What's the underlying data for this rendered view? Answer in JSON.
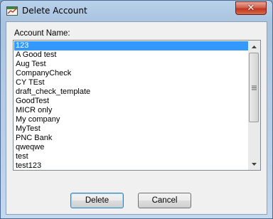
{
  "window": {
    "title": "Delete Account",
    "close_symbol": "✕",
    "icon": "app-icon"
  },
  "form": {
    "label": "Account Name:",
    "accounts": [
      "123",
      "A Good test",
      "Aug Test",
      "CompanyCheck",
      "CY TEst",
      "draft_check_template",
      "GoodTest",
      "MICR only",
      "My company",
      "MyTest",
      "PNC Bank",
      "qweqwe",
      "test",
      "test123"
    ],
    "selected_index": 0,
    "selected_color": "#3399ff"
  },
  "buttons": {
    "delete_label": "Delete",
    "cancel_label": "Cancel"
  }
}
